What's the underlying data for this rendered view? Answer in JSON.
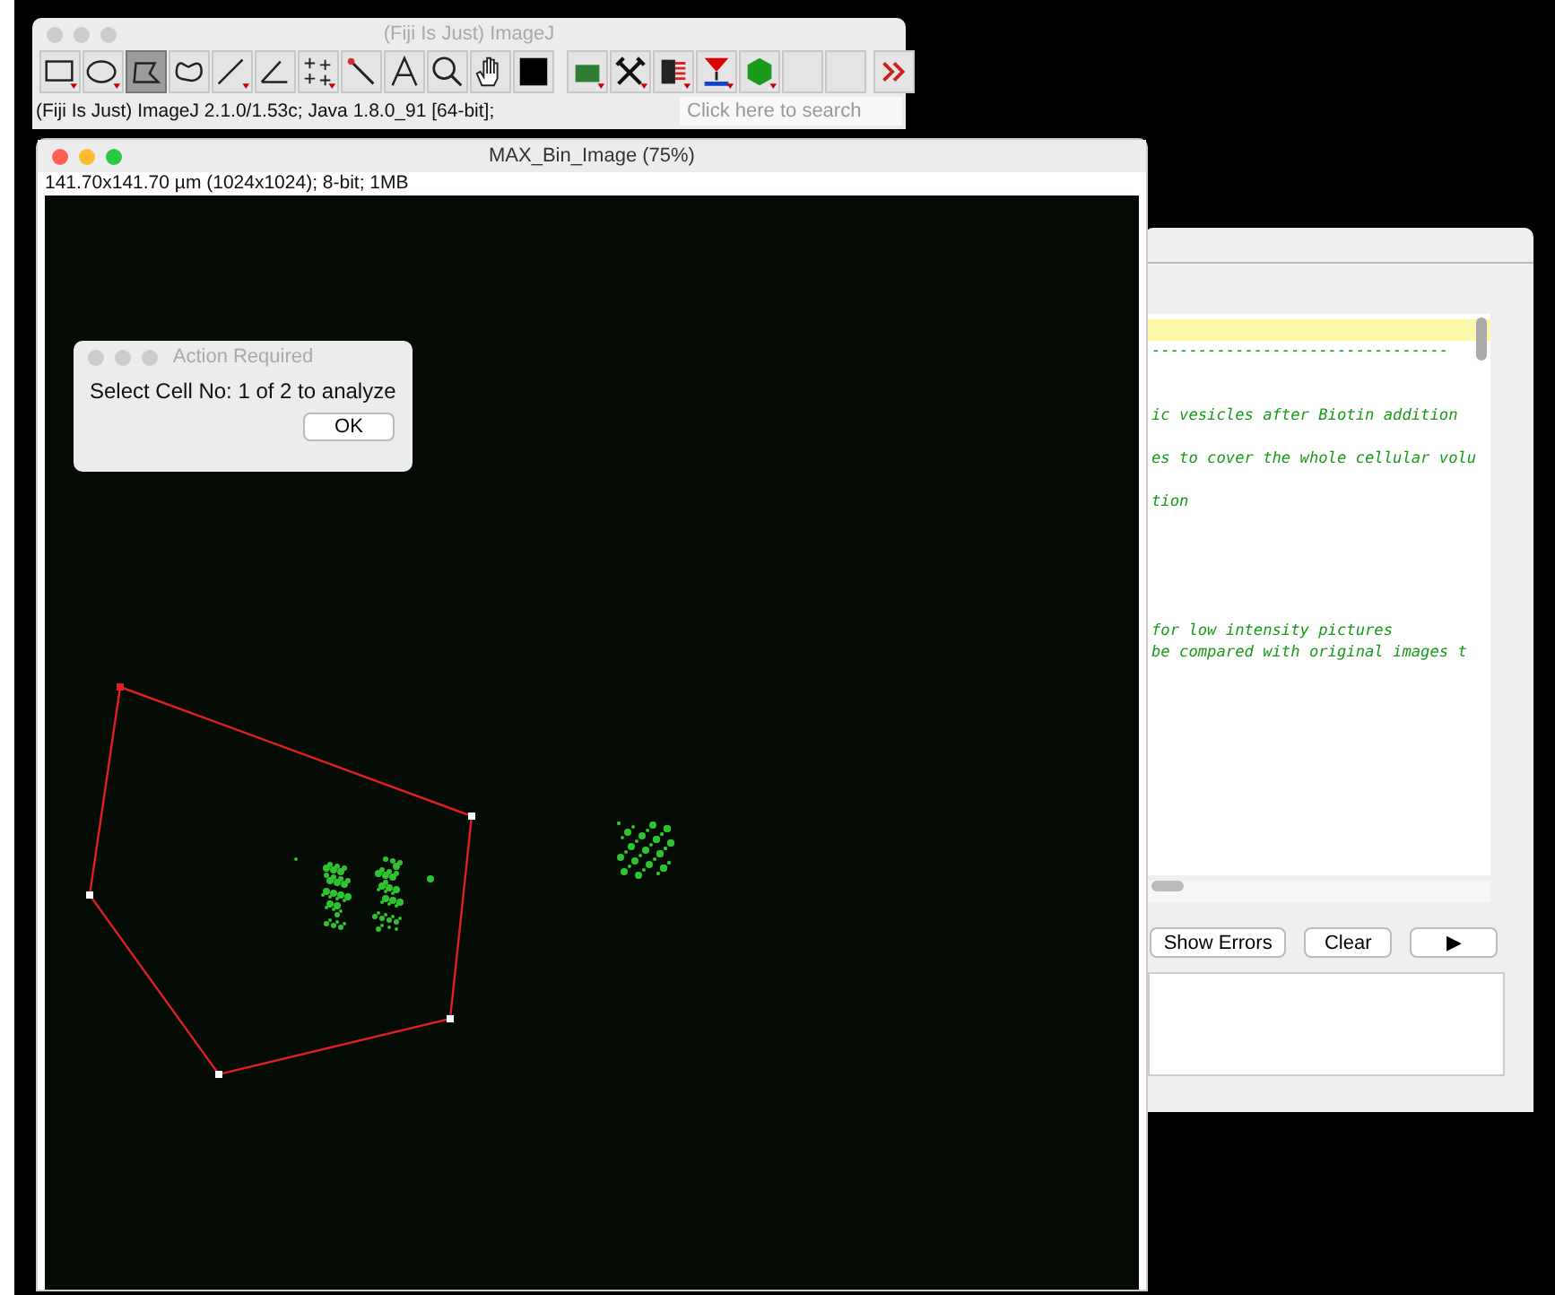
{
  "toolbar_window": {
    "title": "(Fiji Is Just) ImageJ",
    "tools": [
      {
        "kind": "rectangle",
        "selected": false
      },
      {
        "kind": "oval",
        "selected": false
      },
      {
        "kind": "polygon",
        "selected": true
      },
      {
        "kind": "freehand",
        "selected": false
      },
      {
        "kind": "line",
        "selected": false
      },
      {
        "kind": "angle",
        "selected": false
      },
      {
        "kind": "point",
        "selected": false
      },
      {
        "kind": "wand",
        "selected": false
      },
      {
        "kind": "text",
        "selected": false
      },
      {
        "kind": "magnifier",
        "selected": false
      },
      {
        "kind": "hand",
        "selected": false
      },
      {
        "kind": "color",
        "selected": false
      },
      {
        "kind": "folder",
        "selected": false
      },
      {
        "kind": "wrench",
        "selected": false
      },
      {
        "kind": "stack",
        "selected": false
      },
      {
        "kind": "lut",
        "selected": false
      },
      {
        "kind": "hexagon",
        "selected": false
      },
      {
        "kind": "empty",
        "selected": false
      },
      {
        "kind": "empty",
        "selected": false
      },
      {
        "kind": "more",
        "selected": false
      }
    ],
    "status": "(Fiji Is Just) ImageJ 2.1.0/1.53c; Java 1.8.0_91 [64-bit];",
    "search": {
      "placeholder": "Click here to search"
    }
  },
  "editor_window": {
    "lines": [
      {
        "kind": "code",
        "text": "--------------------------------"
      },
      {
        "kind": "blank"
      },
      {
        "kind": "blank"
      },
      {
        "kind": "code",
        "text": "ic vesicles after Biotin addition"
      },
      {
        "kind": "blank"
      },
      {
        "kind": "code",
        "text": "es to cover the whole cellular volu"
      },
      {
        "kind": "blank"
      },
      {
        "kind": "code",
        "text": "tion"
      },
      {
        "kind": "blank"
      },
      {
        "kind": "blank"
      },
      {
        "kind": "blank"
      },
      {
        "kind": "blank"
      },
      {
        "kind": "blank"
      },
      {
        "kind": "code",
        "text": "for low intensity pictures"
      },
      {
        "kind": "code",
        "text": "be compared with original images t"
      }
    ],
    "buttons": [
      "Show Errors",
      "Clear",
      "▶"
    ]
  },
  "image_window": {
    "title": "MAX_Bin_Image (75%)",
    "info": "141.70x141.70 µm (1024x1024); 8-bit; 1MB"
  },
  "dialog": {
    "title": "Action Required",
    "message": "Select Cell No: 1 of 2 to analyze",
    "button": "OK"
  }
}
